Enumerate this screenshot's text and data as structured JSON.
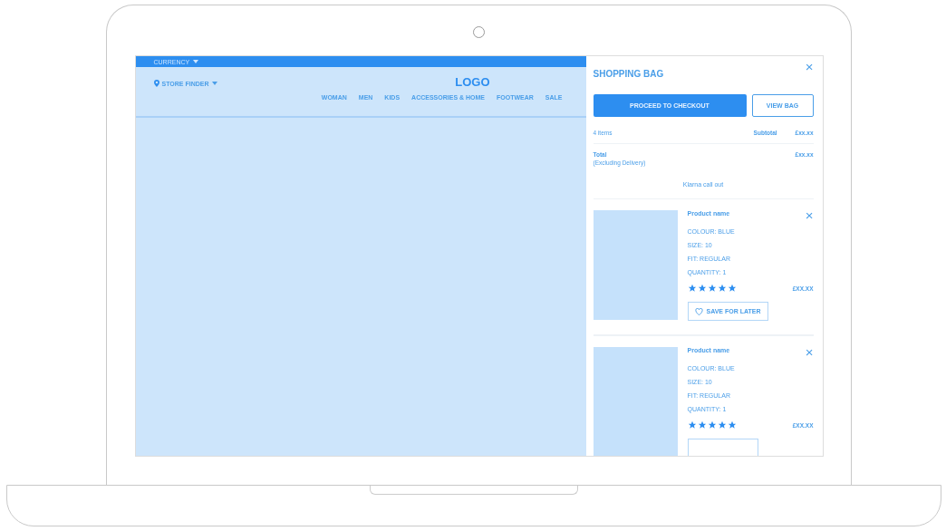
{
  "top_bar": {
    "currency": "CURRENCY"
  },
  "header": {
    "store_finder": "STORE FINDER",
    "logo": "LOGO",
    "nav": [
      "WOMAN",
      "MEN",
      "KIDS",
      "ACCESSORIES & HOME",
      "FOOTWEAR",
      "SALE"
    ]
  },
  "bag": {
    "title": "SHOPPING BAG",
    "close": "×",
    "checkout_button": "PROCEED TO CHECKOUT",
    "view_button": "VIEW BAG",
    "items_count": "4 items",
    "subtotal_label": "Subtotal",
    "subtotal_value": "£xx.xx",
    "total_label": "Total",
    "total_note": "(Excluding Delivery)",
    "total_value": "£xx.xx",
    "klarna": "Klarna call out",
    "products": [
      {
        "name": "Product name",
        "colour": "COLOUR: BLUE",
        "size": "SIZE: 10",
        "fit": "FIT: REGULAR",
        "quantity": "QUANTITY: 1",
        "stars": 5,
        "price": "£XX.XX",
        "save_label": "SAVE FOR LATER"
      },
      {
        "name": "Product name",
        "colour": "COLOUR: BLUE",
        "size": "SIZE: 10",
        "fit": "FIT: REGULAR",
        "quantity": "QUANTITY: 1",
        "stars": 5,
        "price": "£XX.XX"
      }
    ]
  }
}
